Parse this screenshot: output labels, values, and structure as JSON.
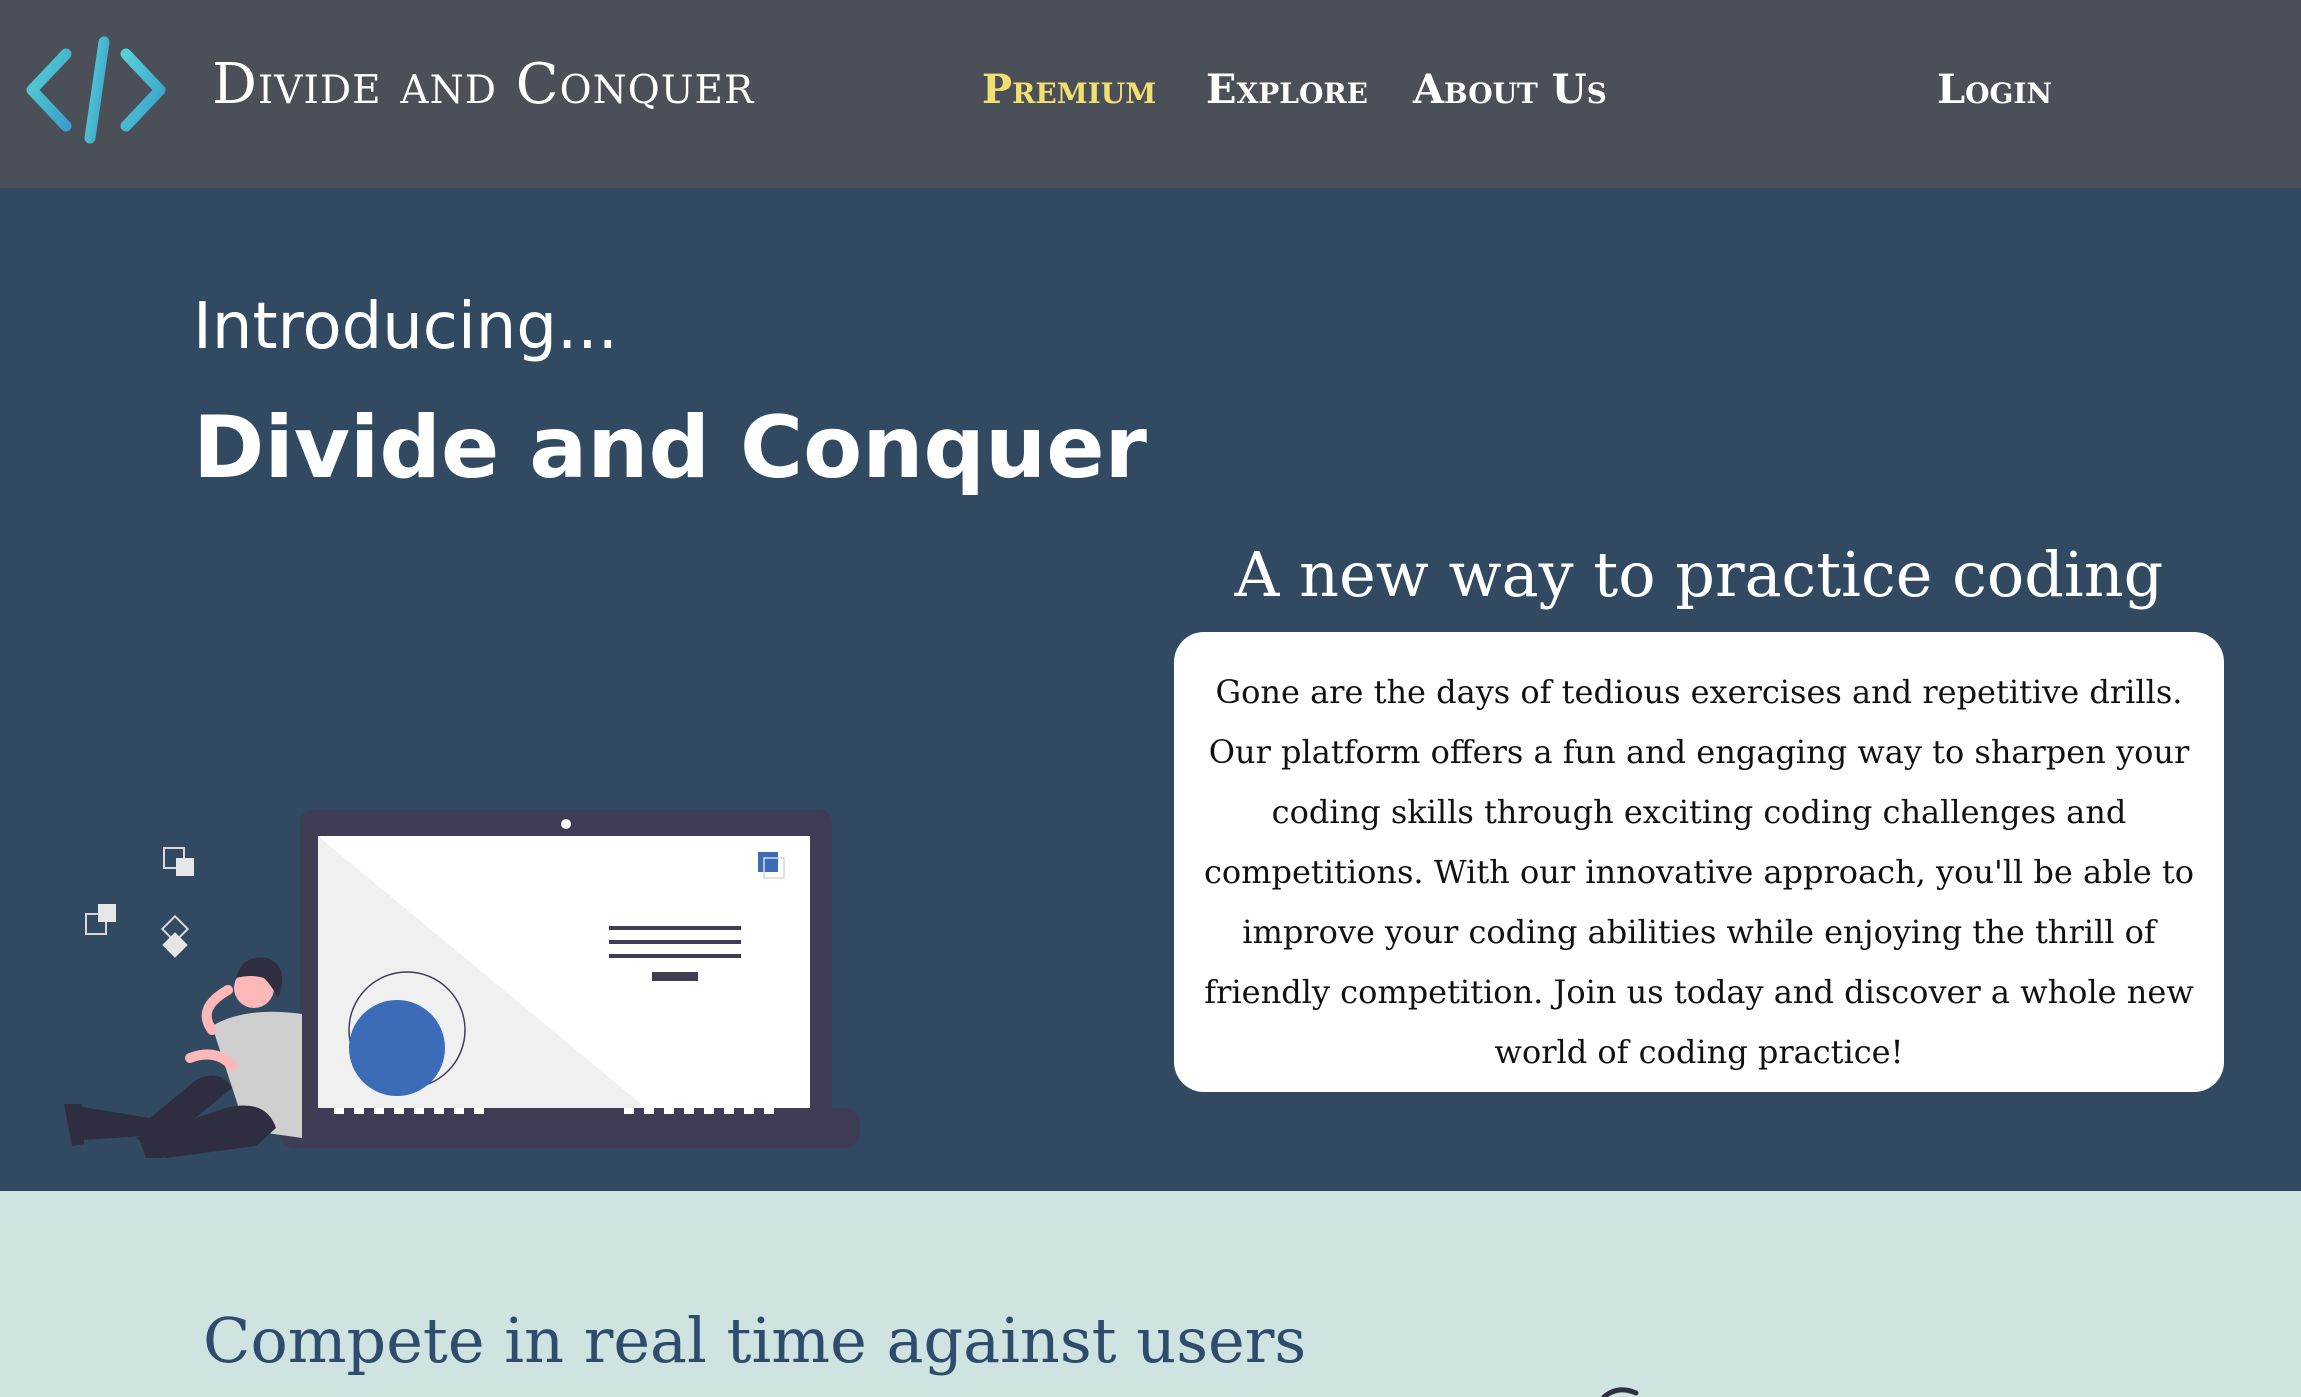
{
  "nav": {
    "brand": "Divide and Conquer",
    "links": [
      "Premium",
      "Explore",
      "About Us"
    ],
    "login": "Login"
  },
  "hero": {
    "intro": "Introducing...",
    "title": "Divide and Conquer",
    "tagline": "A new way to practice coding",
    "description": "Gone are the days of tedious exercises and repetitive drills. Our platform offers a fun and engaging way to sharpen your coding skills through exciting coding challenges and competitions. With our innovative approach, you'll be able to improve your coding abilities while enjoying the thrill of friendly competition. Join us today and discover a whole new world of coding practice!"
  },
  "compete": {
    "title": "Compete in real time against users"
  },
  "colors": {
    "nav_bg": "#4b5058",
    "premium_accent": "#f2df72",
    "hero_bg": "#314a62",
    "section_bg": "#cfe3e0",
    "section_title": "#2f4b6e",
    "illustration_accent": "#3c6bb8",
    "logo_gradient_start": "#4fc7d0",
    "logo_gradient_end": "#3aa0c9"
  },
  "icons": {
    "logo": "code-brackets-icon"
  }
}
